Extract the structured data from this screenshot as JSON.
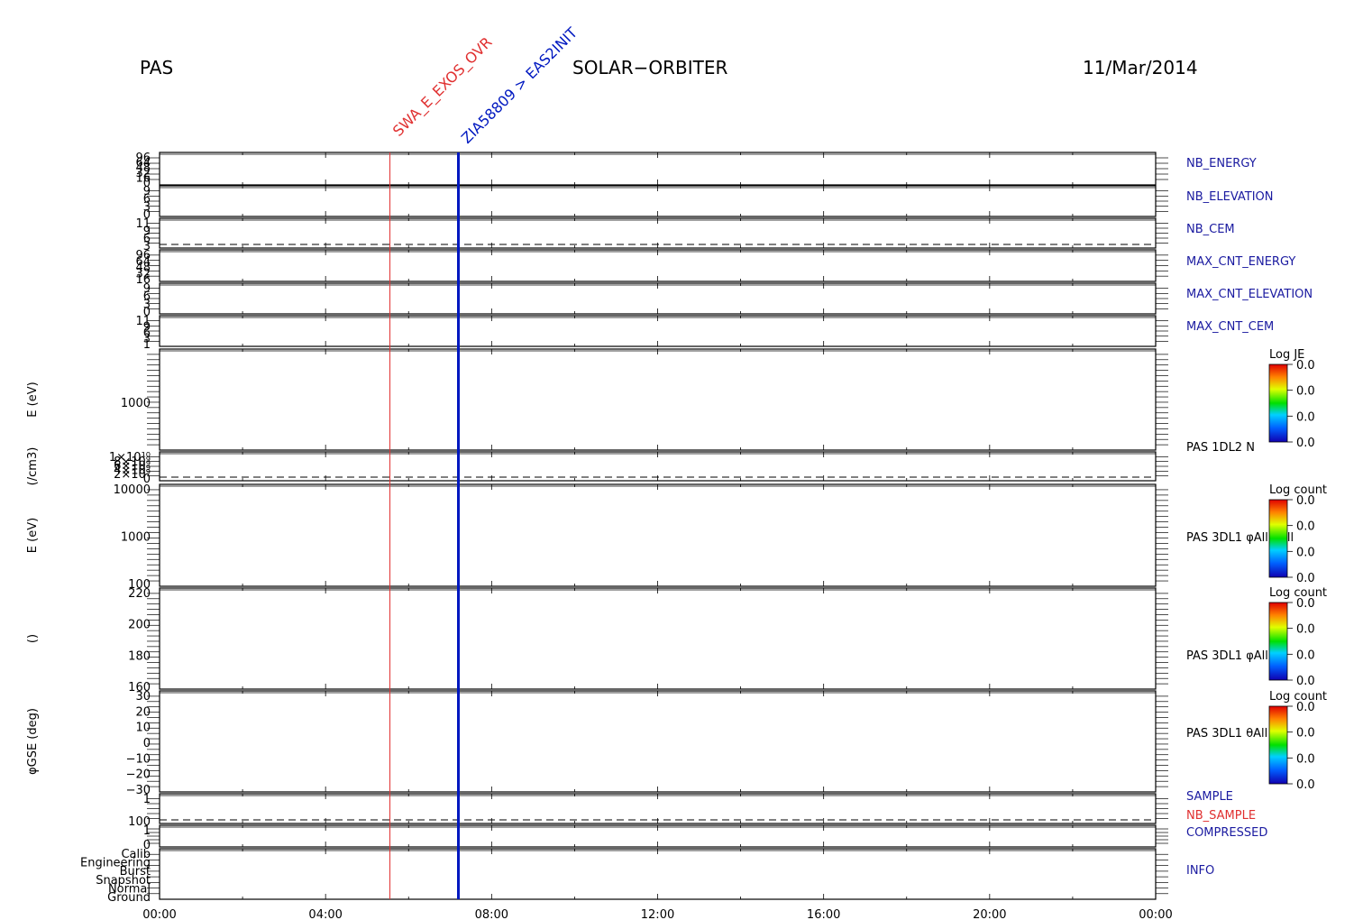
{
  "header": {
    "instrument": "PAS",
    "mission": "SOLAR−ORBITER",
    "date": "11/Mar/2014"
  },
  "markers": [
    {
      "label": "SWA_E_EXOS_OVR",
      "time_h": 5.55,
      "color": "#e03030",
      "width": 1
    },
    {
      "label": "ZIA58809 > EAS2INIT",
      "time_h": 7.2,
      "color": "#0018c0",
      "width": 3
    }
  ],
  "chart_data": {
    "type": "line",
    "x_axis": {
      "range_h": [
        0,
        24
      ],
      "tick_labels": [
        {
          "h": 0,
          "label": "00:00"
        },
        {
          "h": 4,
          "label": "04:00"
        },
        {
          "h": 8,
          "label": "08:00"
        },
        {
          "h": 12,
          "label": "12:00"
        },
        {
          "h": 16,
          "label": "16:00"
        },
        {
          "h": 20,
          "label": "20:00"
        },
        {
          "h": 24,
          "label": "00:00"
        }
      ]
    },
    "panels": [
      {
        "id": "nb-energy",
        "right_label": "NB_ENERGY",
        "label_color": "#1a1aa0",
        "ylabel": "",
        "yticks": [
          "96",
          "64",
          "48",
          "32",
          "16",
          "0"
        ],
        "dashed": false
      },
      {
        "id": "nb-elevation",
        "right_label": "NB_ELEVATION",
        "label_color": "#1a1aa0",
        "ylabel": "",
        "yticks": [
          "9",
          "6",
          "3",
          "0"
        ],
        "dashed": false
      },
      {
        "id": "nb-cem",
        "right_label": "NB_CEM",
        "label_color": "#1a1aa0",
        "ylabel": "",
        "yticks": [
          "11",
          "9",
          "6",
          "3"
        ],
        "dashed": true
      },
      {
        "id": "max-cnt-energy",
        "right_label": "MAX_CNT_ENERGY",
        "label_color": "#1a1aa0",
        "ylabel": "",
        "yticks": [
          "96",
          "64",
          "48",
          "32",
          "16"
        ],
        "dashed": false
      },
      {
        "id": "max-cnt-elevation",
        "right_label": "MAX_CNT_ELEVATION",
        "label_color": "#1a1aa0",
        "ylabel": "",
        "yticks": [
          "9",
          "6",
          "3",
          "0"
        ],
        "dashed": false
      },
      {
        "id": "max-cnt-cem",
        "right_label": "MAX_CNT_CEM",
        "label_color": "#1a1aa0",
        "ylabel": "",
        "yticks": [
          "11",
          "9",
          "6",
          "3",
          "1"
        ],
        "dashed": false
      },
      {
        "id": "pas-1dl2-energy",
        "right_label": "",
        "label_color": "#000000",
        "ylabel": "E (eV)",
        "yticks": [
          "1000"
        ],
        "dashed": false
      },
      {
        "id": "pas-1dl2-density",
        "right_label": "PAS 1DL2 N",
        "label_color": "#000000",
        "ylabel": "(/cm3)",
        "yticks": [
          "1×10¹⁰",
          "8×10⁹",
          "6×10⁹",
          "4×10⁹",
          "2×10⁹",
          "0"
        ],
        "dashed": true
      },
      {
        "id": "pas-3dl1-energy",
        "right_label": "PAS 3DL1 φAll θAll",
        "label_color": "#000000",
        "ylabel": "E (eV)",
        "yticks": [
          "10000",
          "1000",
          "100"
        ],
        "dashed": false
      },
      {
        "id": "pas-3dl1-angle",
        "right_label": "PAS 3DL1 φAll",
        "label_color": "#000000",
        "ylabel": "()",
        "yticks": [
          "220",
          "200",
          "180",
          "160"
        ],
        "dashed": false
      },
      {
        "id": "pas-3dl1-phi",
        "right_label": "PAS 3DL1 θAll",
        "label_color": "#000000",
        "ylabel": "φGSE (deg)",
        "yticks": [
          "30",
          "20",
          "10",
          "0",
          "−10",
          "−20",
          "−30"
        ],
        "dashed": false
      },
      {
        "id": "sample",
        "right_label": "SAMPLE",
        "label_color": "#1a1aa0",
        "ylabel": "",
        "yticks": [
          "1",
          "100"
        ],
        "dashed": true
      },
      {
        "id": "compressed",
        "right_label": "COMPRESSED",
        "label_color": "#1a1aa0",
        "ylabel": "",
        "yticks": [
          "1",
          "0"
        ],
        "dashed": false
      },
      {
        "id": "info",
        "right_label": "INFO",
        "label_color": "#1a1aa0",
        "ylabel": "",
        "yticks": [
          "Calib",
          "Engineering",
          "Burst",
          "Snapshot",
          "Normal",
          "Ground"
        ],
        "dashed": false
      }
    ],
    "extra_labels": {
      "nb_sample": {
        "text": "NB_SAMPLE",
        "color": "#e03030"
      }
    },
    "colorbars": [
      {
        "title": "Log JE",
        "ticks": [
          "0.0",
          "0.0",
          "0.0",
          "0.0"
        ]
      },
      {
        "title": "Log count",
        "ticks": [
          "0.0",
          "0.0",
          "0.0",
          "0.0"
        ]
      },
      {
        "title": "Log count",
        "ticks": [
          "0.0",
          "0.0",
          "0.0",
          "0.0"
        ]
      },
      {
        "title": "Log count",
        "ticks": [
          "0.0",
          "0.0",
          "0.0",
          "0.0"
        ]
      }
    ]
  }
}
